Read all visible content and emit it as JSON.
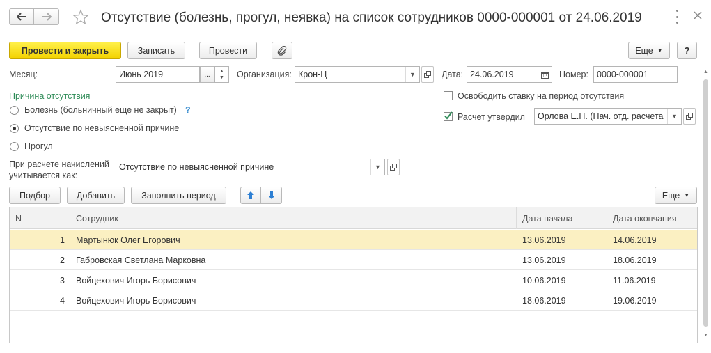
{
  "window": {
    "title": "Отсутствие (болезнь, прогул, неявка) на список сотрудников 0000-000001 от 24.06.2019"
  },
  "toolbar": {
    "post_close": "Провести и закрыть",
    "save": "Записать",
    "post": "Провести",
    "more": "Еще",
    "help": "?"
  },
  "fields": {
    "month_label": "Месяц:",
    "month_value": "Июнь 2019",
    "org_label": "Организация:",
    "org_value": "Крон-Ц",
    "date_label": "Дата:",
    "date_value": "24.06.2019",
    "number_label": "Номер:",
    "number_value": "0000-000001"
  },
  "reason": {
    "title": "Причина отсутствия",
    "options": [
      {
        "label": "Болезнь (больничный еще не закрыт)",
        "help": "?",
        "checked": false
      },
      {
        "label": "Отсутствие по невыясненной причине",
        "checked": true
      },
      {
        "label": "Прогул",
        "checked": false
      }
    ]
  },
  "right_options": {
    "free_rate_label": "Освободить ставку на период отсутствия",
    "free_rate_checked": false,
    "approved_label": "Расчет утвердил",
    "approved_checked": true,
    "approved_value": "Орлова Е.Н. (Нач. отд. расчета"
  },
  "accrual": {
    "label_line1": "При расчете начислений",
    "label_line2": "учитывается как:",
    "value": "Отсутствие по невыясненной причине"
  },
  "table_toolbar": {
    "pick": "Подбор",
    "add": "Добавить",
    "fill_period": "Заполнить период",
    "more": "Еще"
  },
  "table": {
    "columns": [
      "N",
      "Сотрудник",
      "Дата начала",
      "Дата окончания"
    ],
    "rows": [
      {
        "n": "1",
        "employee": "Мартынюк Олег Егорович",
        "start": "13.06.2019",
        "end": "14.06.2019"
      },
      {
        "n": "2",
        "employee": "Габровская Светлана Марковна",
        "start": "13.06.2019",
        "end": "18.06.2019"
      },
      {
        "n": "3",
        "employee": "Войцехович Игорь Борисович",
        "start": "10.06.2019",
        "end": "11.06.2019"
      },
      {
        "n": "4",
        "employee": "Войцехович Игорь Борисович",
        "start": "18.06.2019",
        "end": "19.06.2019"
      }
    ]
  },
  "colors": {
    "primary_button": "#f3d200",
    "reason_title": "#2e8b57",
    "help_mark": "#3d8fd0",
    "selected_row": "#fbf0c2",
    "arrow_blue": "#2d7fd3"
  },
  "icons": [
    "back-arrow-icon",
    "forward-arrow-icon",
    "star-icon",
    "more-vert-icon",
    "close-icon",
    "paperclip-icon",
    "calendar-icon",
    "open-form-icon",
    "dropdown-icon",
    "arrow-up-icon",
    "arrow-down-icon",
    "spin-up-icon",
    "spin-down-icon",
    "ellipsis-icon"
  ]
}
